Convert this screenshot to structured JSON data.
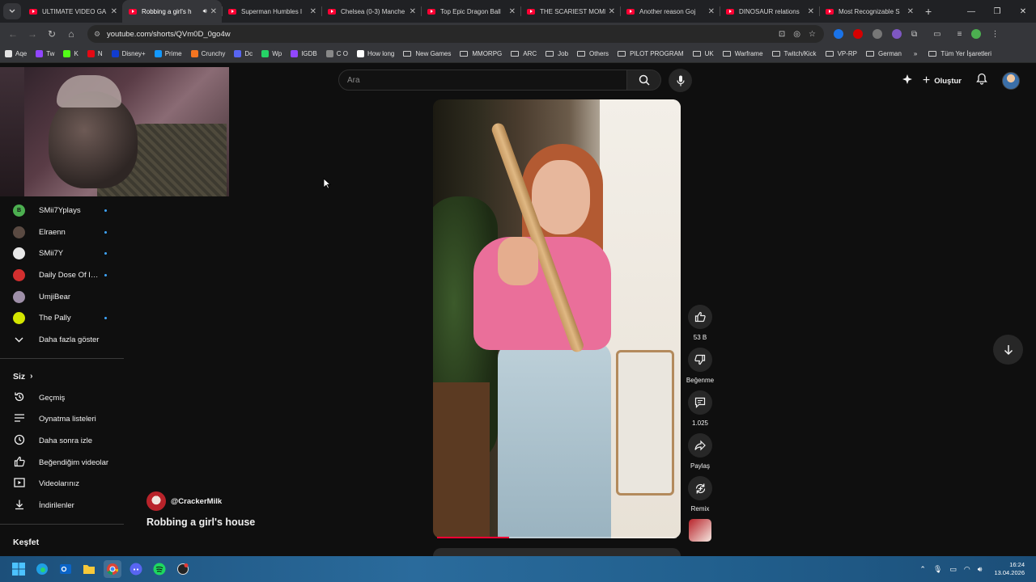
{
  "browser": {
    "tabs": [
      {
        "title": "ULTIMATE VIDEO GA",
        "active": false,
        "audio": false
      },
      {
        "title": "Robbing a girl's h",
        "active": true,
        "audio": true
      },
      {
        "title": "Superman Humbles I",
        "active": false,
        "audio": false
      },
      {
        "title": "Chelsea (0-3) Manche",
        "active": false,
        "audio": false
      },
      {
        "title": "Top Epic Dragon Ball",
        "active": false,
        "audio": false
      },
      {
        "title": "THE SCARIEST MOME",
        "active": false,
        "audio": false
      },
      {
        "title": "Another reason Goj",
        "active": false,
        "audio": false
      },
      {
        "title": "DINOSAUR relations",
        "active": false,
        "audio": false
      },
      {
        "title": "Most Recognizable S",
        "active": false,
        "audio": false
      }
    ],
    "url": "youtube.com/shorts/QVm0D_0go4w",
    "bookmarks": [
      {
        "label": "Aqe",
        "icon": "bookmark-favicon",
        "color": "#e3e3e3"
      },
      {
        "label": "Tw",
        "icon": "bookmark-favicon",
        "color": "#9146ff"
      },
      {
        "label": "K",
        "icon": "bookmark-favicon",
        "color": "#53fc18"
      },
      {
        "label": "N",
        "icon": "bookmark-favicon",
        "color": "#e50914"
      },
      {
        "label": "Disney+",
        "icon": "bookmark-favicon",
        "color": "#113ccf"
      },
      {
        "label": "Prime",
        "icon": "bookmark-favicon",
        "color": "#1399ff"
      },
      {
        "label": "Crunchy",
        "icon": "bookmark-favicon",
        "color": "#f47521"
      },
      {
        "label": "Dc",
        "icon": "bookmark-favicon",
        "color": "#5865f2"
      },
      {
        "label": "Wp",
        "icon": "bookmark-favicon",
        "color": "#25d366"
      },
      {
        "label": "IGDB",
        "icon": "bookmark-favicon",
        "color": "#9147ff"
      },
      {
        "label": "C O",
        "icon": "bookmark-favicon",
        "color": "#888888"
      },
      {
        "label": "How long",
        "icon": "bookmark-favicon",
        "color": "#ffffff"
      },
      {
        "label": "New Games",
        "icon": "folder-icon",
        "color": ""
      },
      {
        "label": "MMORPG",
        "icon": "folder-icon",
        "color": ""
      },
      {
        "label": "ARC",
        "icon": "folder-icon",
        "color": ""
      },
      {
        "label": "Job",
        "icon": "folder-icon",
        "color": ""
      },
      {
        "label": "Others",
        "icon": "folder-icon",
        "color": ""
      },
      {
        "label": "PILOT PROGRAM",
        "icon": "folder-icon",
        "color": ""
      },
      {
        "label": "UK",
        "icon": "folder-icon",
        "color": ""
      },
      {
        "label": "Warframe",
        "icon": "folder-icon",
        "color": ""
      },
      {
        "label": "Twitch/Kick",
        "icon": "folder-icon",
        "color": ""
      },
      {
        "label": "VP-RP",
        "icon": "folder-icon",
        "color": ""
      },
      {
        "label": "German",
        "icon": "folder-icon",
        "color": ""
      }
    ],
    "bookmarks_more": "»",
    "all_bookmarks": "Tüm Yer İşaretleri"
  },
  "youtube": {
    "search_placeholder": "Ara",
    "create_label": "Oluştur",
    "subscriptions": [
      {
        "name": "SMii7Yplays",
        "avatar_color": "#4caf50",
        "avatar_text": "B",
        "live": true
      },
      {
        "name": "Elraenn",
        "avatar_color": "#5a4a42",
        "avatar_text": "",
        "live": true
      },
      {
        "name": "SMii7Y",
        "avatar_color": "#e8e8e8",
        "avatar_text": "",
        "live": true
      },
      {
        "name": "Daily Dose Of Internet",
        "avatar_color": "#d32f2f",
        "avatar_text": "",
        "live": true
      },
      {
        "name": "UmjiBear",
        "avatar_color": "#9e8fa8",
        "avatar_text": "",
        "live": false
      },
      {
        "name": "The Pally",
        "avatar_color": "#d4e600",
        "avatar_text": "",
        "live": true
      }
    ],
    "show_more": "Daha fazla göster",
    "you_section": {
      "heading": "Siz",
      "items": [
        {
          "label": "Geçmiş",
          "icon": "history-icon"
        },
        {
          "label": "Oynatma listeleri",
          "icon": "playlists-icon"
        },
        {
          "label": "Daha sonra izle",
          "icon": "watch-later-icon"
        },
        {
          "label": "Beğendiğim videolar",
          "icon": "liked-videos-icon"
        },
        {
          "label": "Videolarınız",
          "icon": "your-videos-icon"
        },
        {
          "label": "İndirilenler",
          "icon": "downloads-icon"
        }
      ]
    },
    "explore_heading": "Keşfet",
    "short": {
      "channel": "@CrackerMilk",
      "title": "Robbing a girl's house",
      "progress_fraction": 0.3,
      "actions": [
        {
          "name": "like",
          "label": "53 B",
          "icon": "thumb-up-icon"
        },
        {
          "name": "dislike",
          "label": "Beğenme",
          "icon": "thumb-down-icon"
        },
        {
          "name": "comments",
          "label": "1.025",
          "icon": "comment-icon"
        },
        {
          "name": "share",
          "label": "Paylaş",
          "icon": "share-icon"
        },
        {
          "name": "remix",
          "label": "Remix",
          "icon": "remix-icon"
        }
      ]
    }
  },
  "taskbar": {
    "time": "16:24",
    "date": "13.04.2026"
  }
}
